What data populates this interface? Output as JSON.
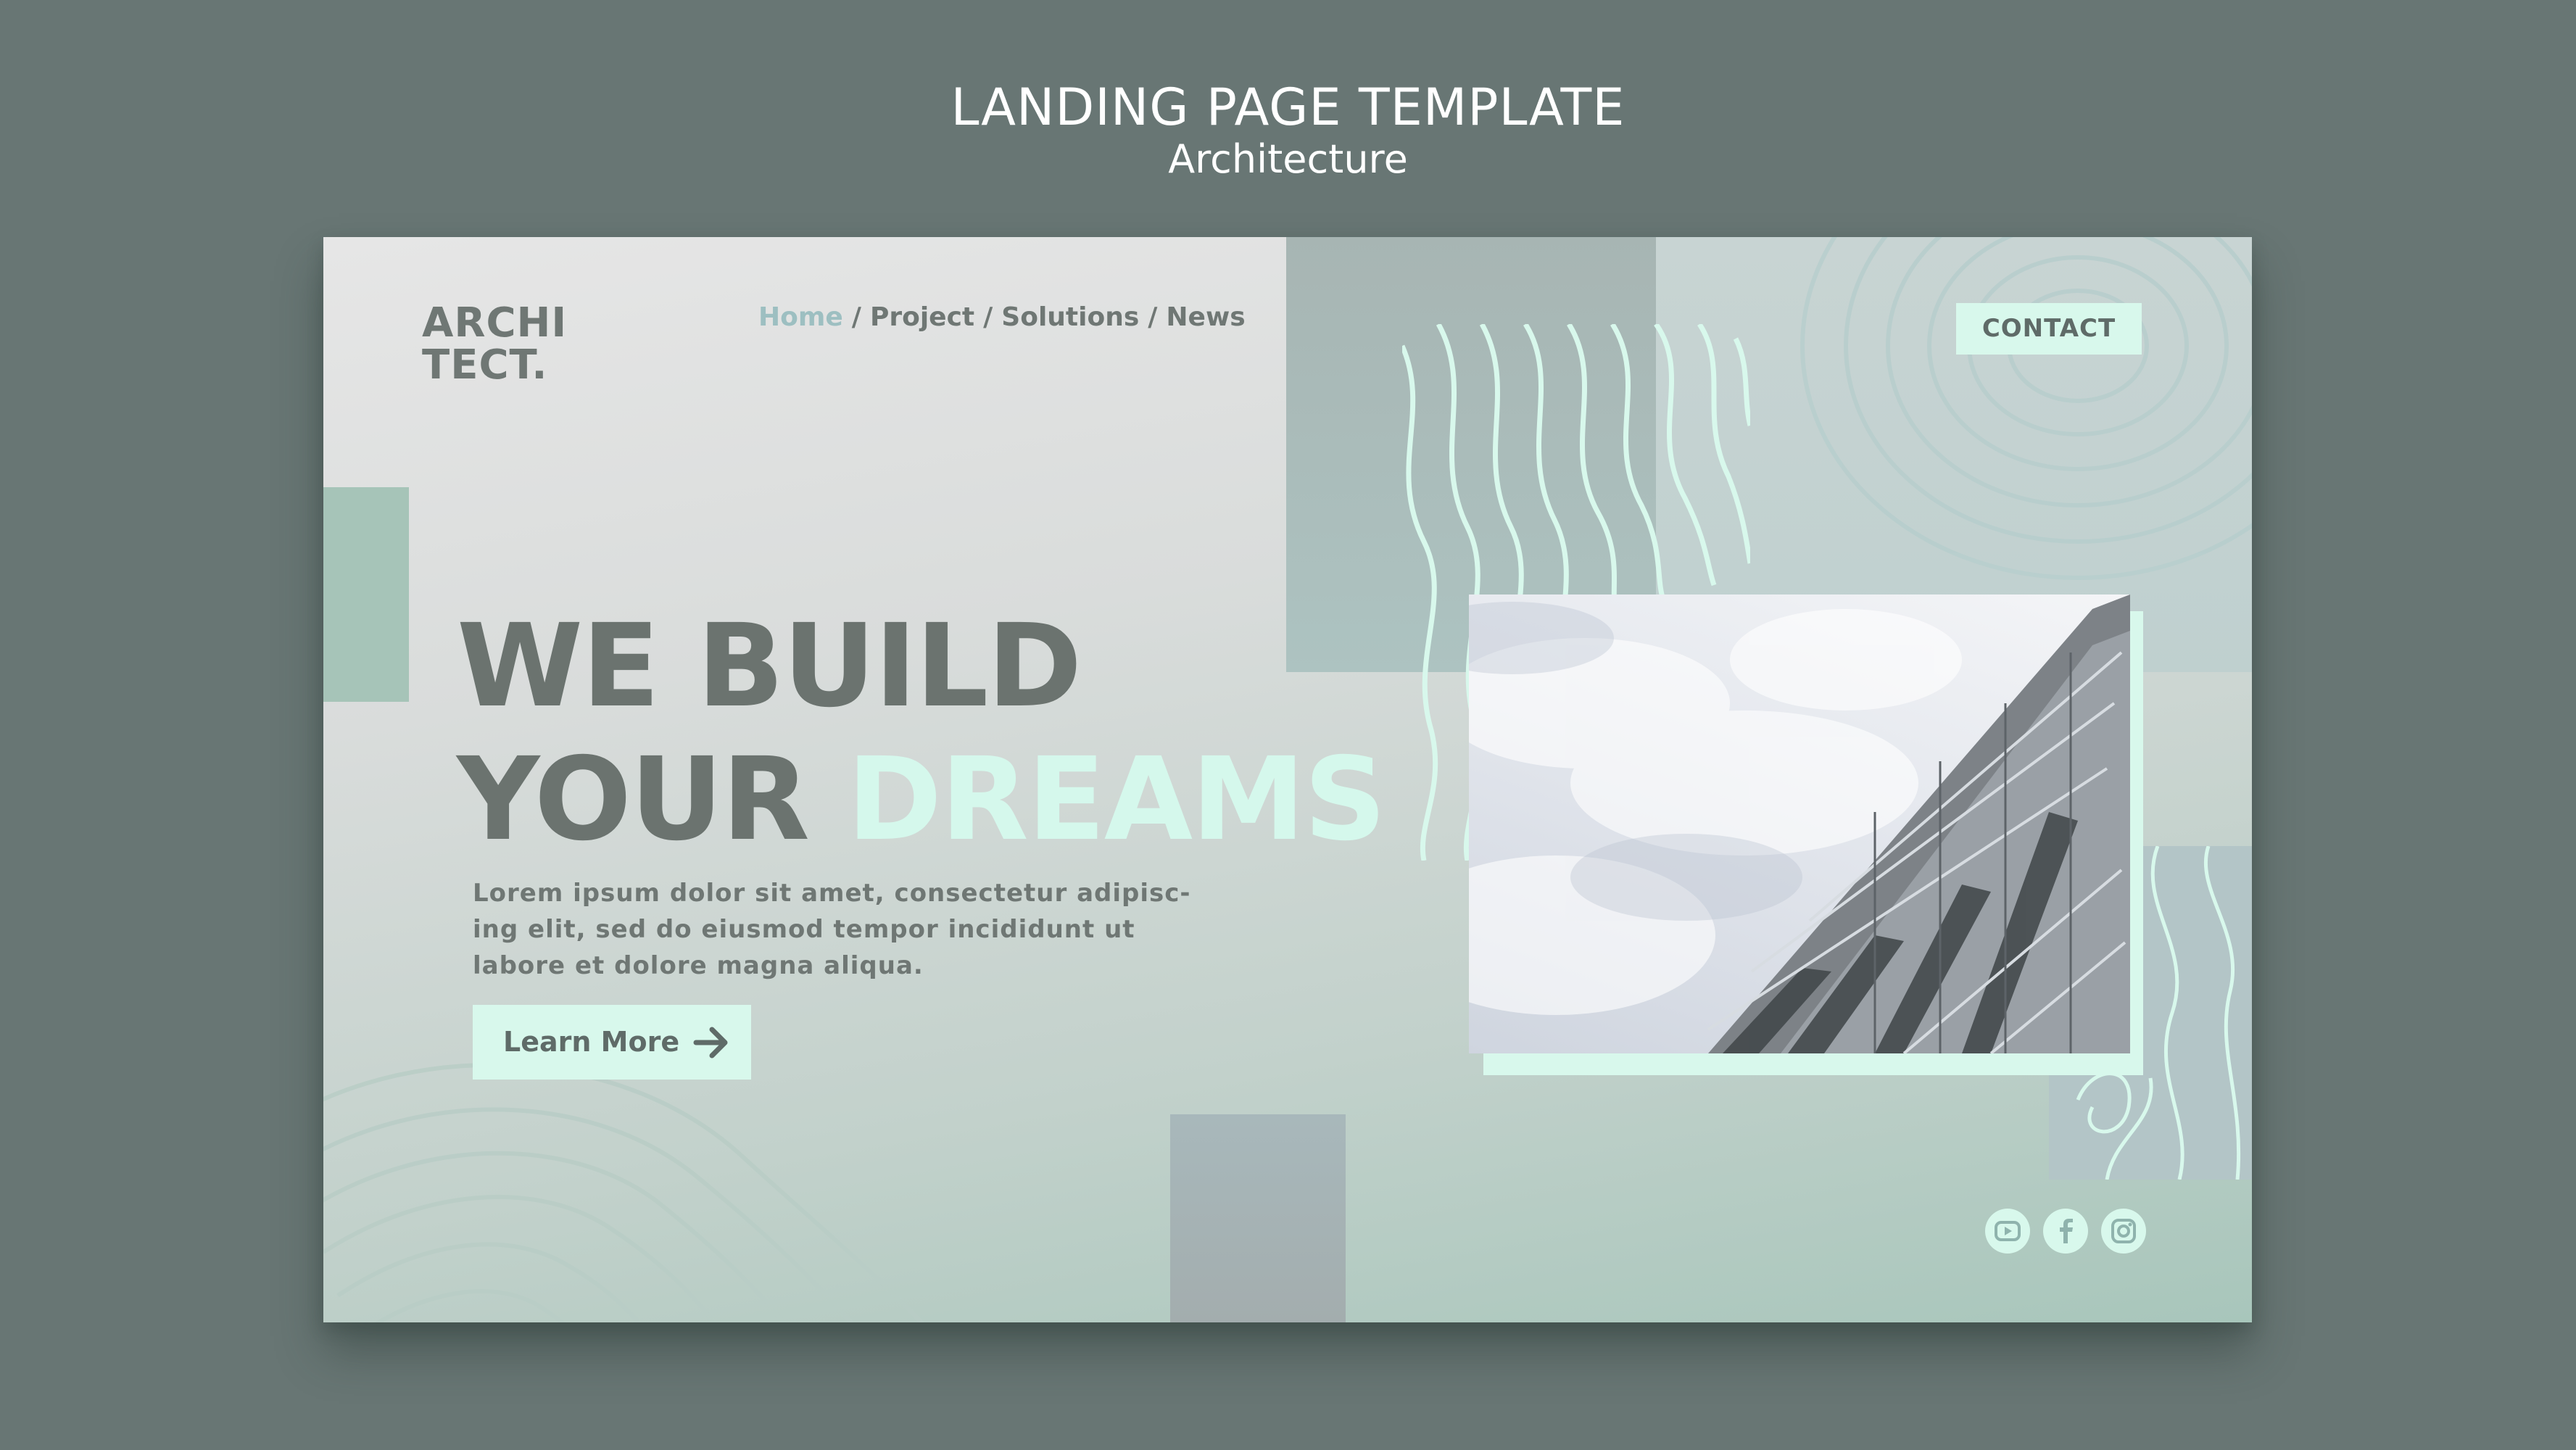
{
  "page": {
    "title": "LANDING PAGE TEMPLATE",
    "subtitle": "Architecture"
  },
  "header": {
    "logo_line1": "ARCHI",
    "logo_line2": "TECT.",
    "nav": [
      {
        "label": "Home",
        "active": true
      },
      {
        "label": "Project",
        "active": false
      },
      {
        "label": "Solutions",
        "active": false
      },
      {
        "label": "News",
        "active": false
      }
    ],
    "nav_separator": "/",
    "contact_label": "CONTACT"
  },
  "hero": {
    "line1": "WE BUILD",
    "line2_part1": "YOUR",
    "line2_highlight": "DREAMS",
    "lead": "Lorem ipsum dolor sit amet, consectetur adipisc-ing elit, sed do eiusmod tempor incididunt ut labore et dolore magna aliqua.",
    "button_label": "Learn More"
  },
  "social": [
    "youtube-icon",
    "facebook-icon",
    "instagram-icon"
  ],
  "colors": {
    "background": "#687674",
    "mint": "#d8f8ec",
    "text_dark": "#6b736f",
    "nav_active": "#9dbfc1"
  }
}
